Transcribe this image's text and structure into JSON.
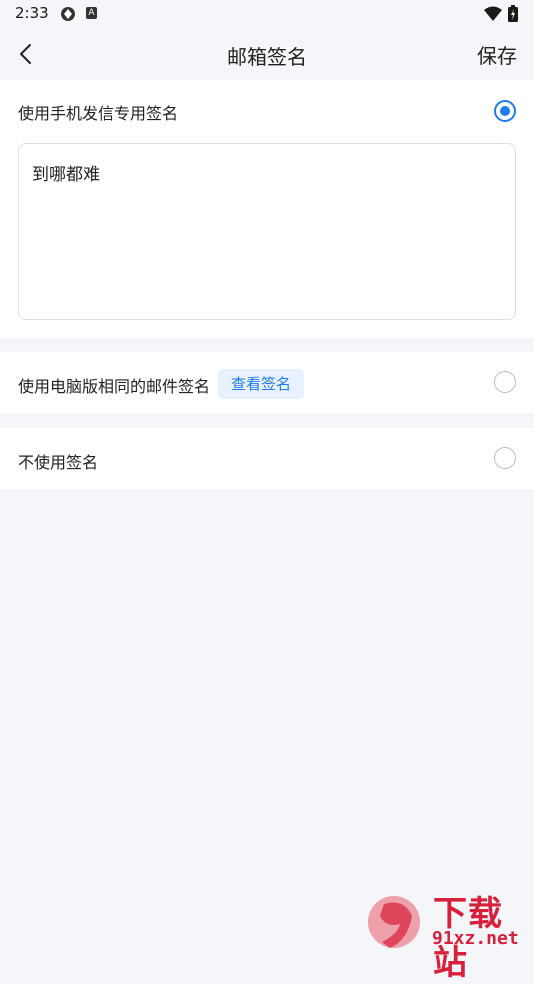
{
  "status_bar": {
    "time": "2:33",
    "notif_letter": "A"
  },
  "header": {
    "title": "邮箱签名",
    "save_label": "保存"
  },
  "options": [
    {
      "label": "使用手机发信专用签名",
      "selected": true
    },
    {
      "label": "使用电脑版相同的邮件签名",
      "selected": false,
      "action_label": "查看签名"
    },
    {
      "label": "不使用签名",
      "selected": false
    }
  ],
  "signature": {
    "value": "到哪都难"
  },
  "watermark": {
    "brand": "下载站",
    "domain": "91xz.net"
  },
  "colors": {
    "accent": "#1e7cf0",
    "background": "#f5f6fa",
    "watermark": "#d8203a"
  }
}
